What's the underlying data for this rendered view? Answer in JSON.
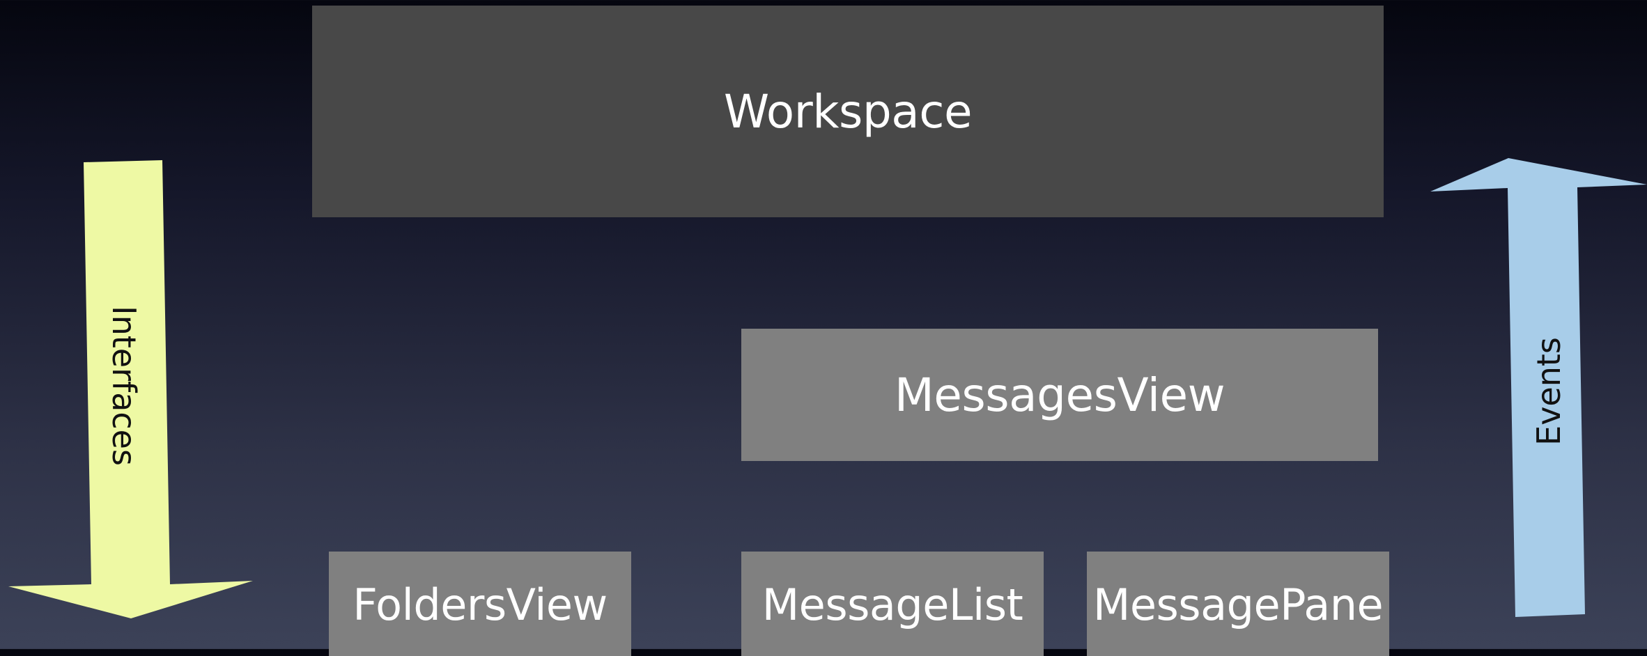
{
  "diagram": {
    "boxes": {
      "workspace": "Workspace",
      "messages_view": "MessagesView",
      "folders_view": "FoldersView",
      "message_list": "MessageList",
      "message_pane": "MessagePane"
    },
    "arrows": {
      "interfaces": {
        "label": "Interfaces",
        "direction": "down",
        "color": "#eef9a4"
      },
      "events": {
        "label": "Events",
        "direction": "up",
        "color": "#a8cde9"
      }
    },
    "colors": {
      "workspace_box": "#484848",
      "view_box": "#808080",
      "text": "#ffffff"
    }
  }
}
